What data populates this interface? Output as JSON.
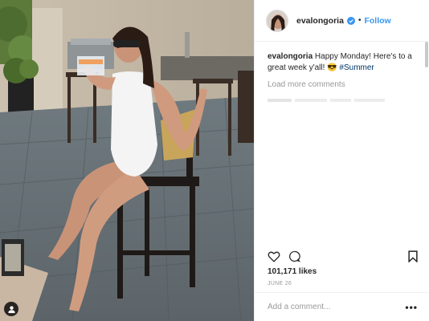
{
  "post": {
    "username": "evalongoria",
    "follow_label": "Follow",
    "dot": "•",
    "caption_user": "evalongoria",
    "caption_text": " Happy Monday! Here's to a great week y'all! 😎 ",
    "hashtag": "#Summer",
    "load_more": "Load more comments",
    "likes": "101,171 likes",
    "date": "JUNE 26",
    "comment_placeholder": "Add a comment...",
    "more_options": "•••"
  },
  "colors": {
    "link_blue": "#3897f0",
    "hashtag": "#003569",
    "meta_gray": "#999999"
  },
  "icons": [
    "verified-badge-icon",
    "heart-icon",
    "comment-icon",
    "bookmark-icon",
    "user-tag-icon"
  ]
}
